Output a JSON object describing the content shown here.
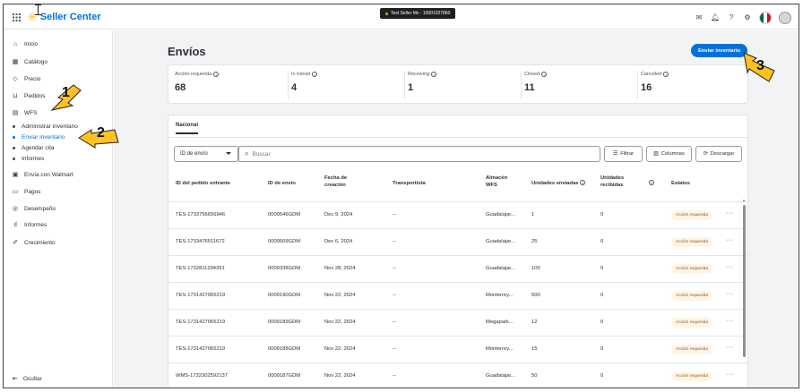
{
  "topbar": {
    "app_name": "Seller Center",
    "seller_label": "Test Seller Mx - 10001027860",
    "icons": [
      "mail-icon",
      "bell-icon",
      "help-icon",
      "settings-icon",
      "flag-mexico-icon",
      "avatar"
    ]
  },
  "sidebar": {
    "items": [
      {
        "label": "Inicio",
        "icon": "home-icon"
      },
      {
        "label": "Catálogo",
        "icon": "catalog-icon"
      },
      {
        "label": "Precio",
        "icon": "price-tag-icon"
      },
      {
        "label": "Pedidos",
        "icon": "cart-icon"
      },
      {
        "label": "WFS",
        "icon": "warehouse-icon"
      }
    ],
    "wfs_subitems": [
      {
        "label": "Administrar inventario",
        "active": false
      },
      {
        "label": "Enviar inventario",
        "active": true
      },
      {
        "label": "Agendar cita",
        "active": false
      },
      {
        "label": "Informes",
        "active": false
      }
    ],
    "items_after": [
      {
        "label": "Envía con Walmart",
        "icon": "shipping-icon"
      },
      {
        "label": "Pagos",
        "icon": "payments-icon"
      },
      {
        "label": "Desempeño",
        "icon": "performance-icon"
      },
      {
        "label": "Informes",
        "icon": "reports-icon"
      },
      {
        "label": "Crecimiento",
        "icon": "growth-icon"
      }
    ],
    "hide_label": "Ocultar"
  },
  "main": {
    "title": "Envíos",
    "send_button": "Enviar inventario",
    "stats": [
      {
        "label": "Acción requerida",
        "value": "68"
      },
      {
        "label": "In transit",
        "value": "4"
      },
      {
        "label": "Receiving",
        "value": "1"
      },
      {
        "label": "Closed",
        "value": "11"
      },
      {
        "label": "Canceled",
        "value": "16"
      }
    ],
    "tab": "Nacional",
    "filter": {
      "select_value": "ID de envío",
      "search_placeholder": "Buscar",
      "filter_button": "Filtrar",
      "columns_button": "Columnas",
      "download_button": "Descargar"
    },
    "table": {
      "headers": [
        "ID del pedido entrante",
        "ID de envío",
        "Fecha de creación",
        "Transportista",
        "Almacén WFS",
        "Unidades enviadas",
        "Unidades recibidas",
        "",
        "Estatus"
      ],
      "rows": [
        [
          "TES-1733756656946",
          "0009546GDM",
          "Dec 9, 2024",
          "--",
          "Guadalajar...",
          "1",
          "0",
          "Acción requerida"
        ],
        [
          "TES-1733476511672",
          "0009509GDM",
          "Dec 6, 2024",
          "--",
          "Guadalajar...",
          "25",
          "0",
          "Acción requerida"
        ],
        [
          "TES-1732811294391",
          "0009338GDM",
          "Nov 28, 2024",
          "--",
          "Guadalajar...",
          "100",
          "0",
          "Acción requerida"
        ],
        [
          "TES-1731427065219",
          "0009190GDM",
          "Nov 22, 2024",
          "--",
          "Monterrey...",
          "500",
          "0",
          "Acción requerida"
        ],
        [
          "TES-1731427065219",
          "0009189GDM",
          "Nov 22, 2024",
          "--",
          "Megapark...",
          "12",
          "0",
          "Acción requerida"
        ],
        [
          "TES-1731427065219",
          "0009188GDM",
          "Nov 22, 2024",
          "--",
          "Monterrey...",
          "15",
          "0",
          "Acción requerida"
        ],
        [
          "WMS-1732302592137",
          "0009187GDM",
          "Nov 22, 2024",
          "--",
          "Guadalajar...",
          "50",
          "0",
          "Acción requerida"
        ]
      ]
    }
  },
  "callouts": [
    "1",
    "2",
    "3"
  ],
  "colors": {
    "accent": "#0071dc",
    "spark": "#ffc220",
    "callout_arrow": "#ffc220",
    "badge_bg": "#fff5e6",
    "badge_text": "#995213"
  }
}
